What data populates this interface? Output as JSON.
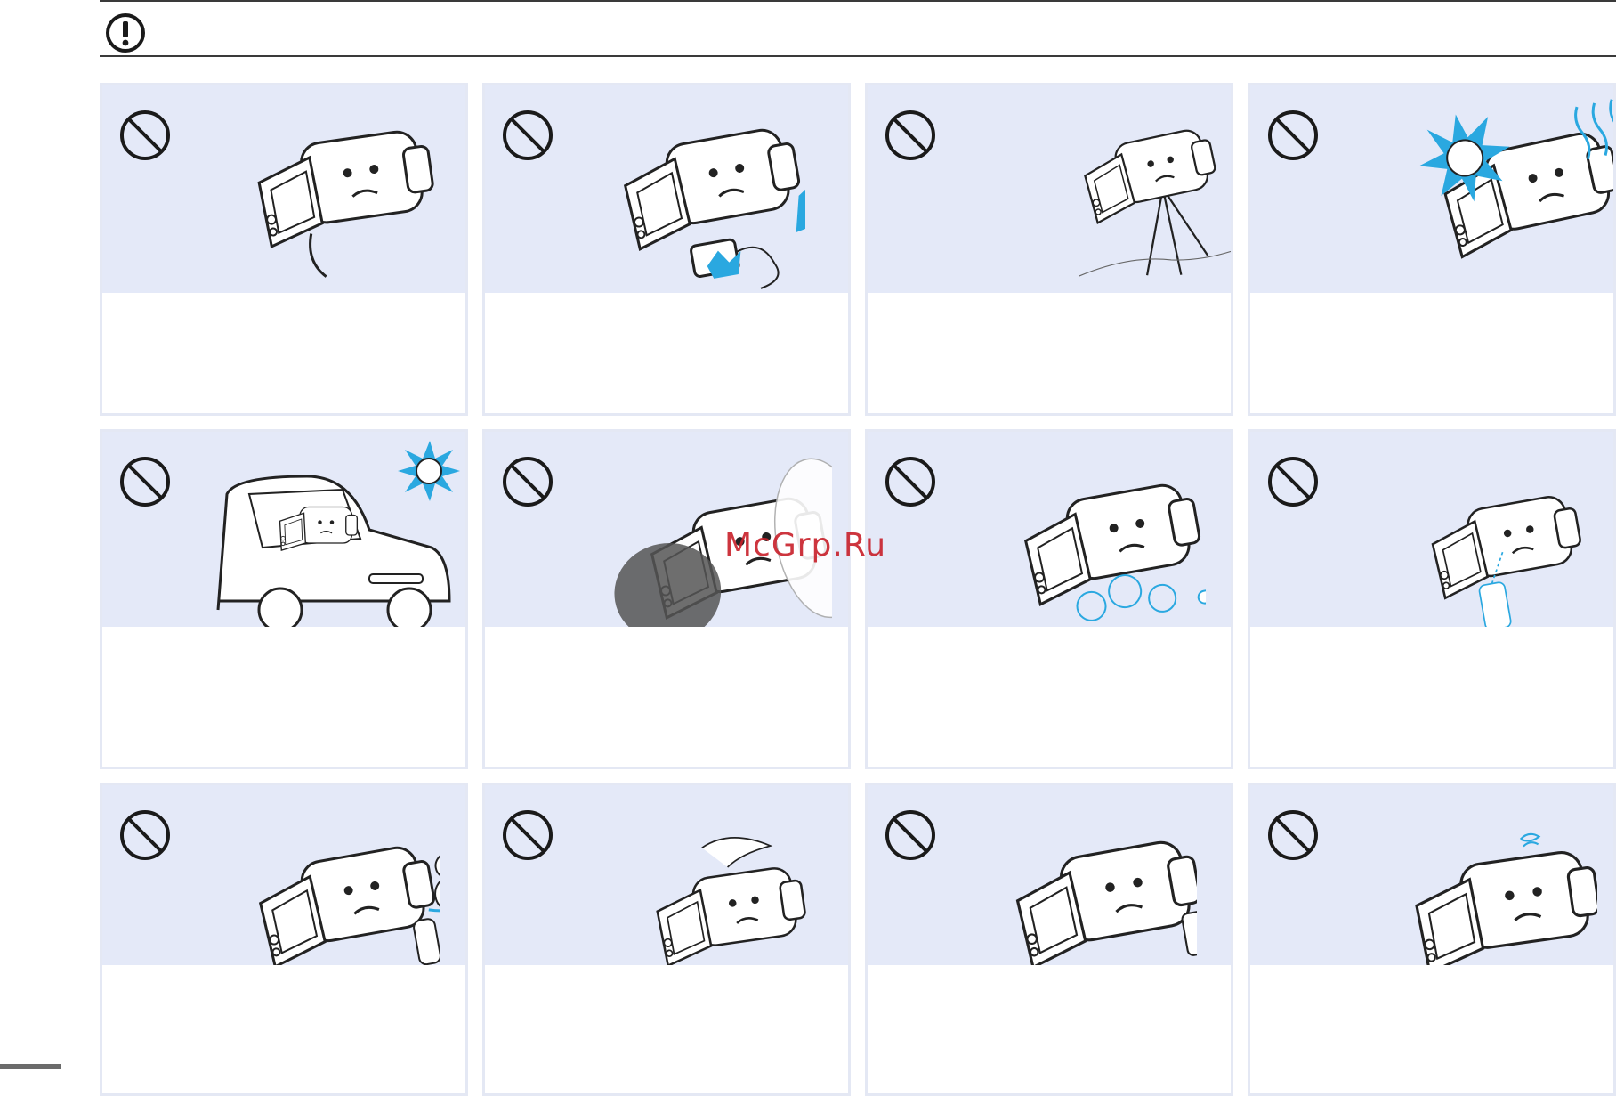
{
  "header": {
    "icon": "exclamation-circle-icon"
  },
  "watermark": {
    "text": "McGrp.Ru"
  },
  "colors": {
    "illustration_bg": "#e4e9f8",
    "card_border": "#e4e8f4",
    "accent_blue": "#2aa8e0",
    "rule": "#3a3a3a"
  },
  "cards": [
    {
      "icon": "prohibition-icon",
      "illustration": "camcorder-disassembly-screwdriver",
      "text": ""
    },
    {
      "icon": "prohibition-icon",
      "illustration": "camcorder-power-adapter-shock",
      "text": ""
    },
    {
      "icon": "prohibition-icon",
      "illustration": "camcorder-tripod-unstable-ground",
      "text": ""
    },
    {
      "icon": "prohibition-icon",
      "illustration": "camcorder-direct-sunlight-heat",
      "text": ""
    },
    {
      "icon": "prohibition-icon",
      "illustration": "camcorder-in-hot-car",
      "text": ""
    },
    {
      "icon": "prohibition-icon",
      "illustration": "camcorder-smoke-dust",
      "text": ""
    },
    {
      "icon": "prohibition-icon",
      "illustration": "camcorder-steam-humidity",
      "text": ""
    },
    {
      "icon": "prohibition-icon",
      "illustration": "camcorder-chemical-spray",
      "text": ""
    },
    {
      "icon": "prohibition-icon",
      "illustration": "camcorder-cold-condensation",
      "text": ""
    },
    {
      "icon": "prohibition-icon",
      "illustration": "camcorder-drop-impact",
      "text": ""
    },
    {
      "icon": "prohibition-icon",
      "illustration": "camcorder-magnetic-devices",
      "text": ""
    },
    {
      "icon": "prohibition-icon",
      "illustration": "camcorder-overheat-tired",
      "text": ""
    }
  ]
}
